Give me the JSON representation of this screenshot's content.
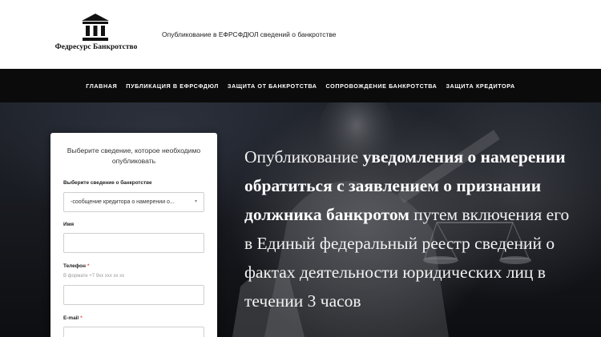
{
  "header": {
    "logo_text": "Федресурс Банкротство",
    "logo_icon": "columns-building-icon",
    "tagline": "Опубликование в ЕФРСФДЮЛ сведений о банкротстве"
  },
  "nav": {
    "items": [
      {
        "label": "Главная"
      },
      {
        "label": "Публикация в ЕФРСФДЮЛ"
      },
      {
        "label": "Защита от банкротства"
      },
      {
        "label": "Сопровождение банкротства"
      },
      {
        "label": "Защита кредитора"
      }
    ]
  },
  "form": {
    "title": "Выберите сведение, которое необходимо опубликовать",
    "select_label": "Выберите сведение о банкротстве",
    "select_value": "-сообщение кредитора о намерении о...",
    "name_label": "Имя",
    "phone_label": "Телефон",
    "phone_hint": "В формате +7 9xx xxx xx xx",
    "email_label": "E-mail",
    "required_mark": "*"
  },
  "hero": {
    "text_1": "Опубликование ",
    "text_2": "уведомления о намерении обратиться с заявлением о признании должника банкротом",
    "text_3": " путем включения его в Единый федеральный реестр сведений о фактах деятельности юридических лиц в течении 3 часов"
  },
  "colors": {
    "nav_bg": "#0b0b0b",
    "required": "#d9534f"
  }
}
